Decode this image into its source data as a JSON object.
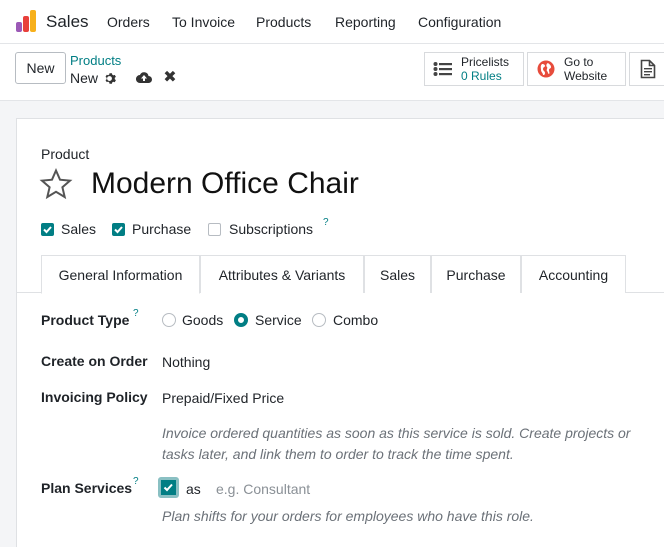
{
  "app": {
    "name": "Sales",
    "logo_colors": [
      "#e8403b",
      "#f7b01b",
      "#9b59b6"
    ]
  },
  "nav": [
    "Orders",
    "To Invoice",
    "Products",
    "Reporting",
    "Configuration"
  ],
  "control": {
    "new_label": "New",
    "breadcrumb_parent": "Products",
    "breadcrumb_current": "New",
    "smart_buttons": [
      {
        "label": "Pricelists",
        "value": "0 Rules",
        "icon": "list-icon"
      },
      {
        "label": "Go to",
        "value": "Website",
        "icon": "globe-icon"
      }
    ]
  },
  "form": {
    "product_label": "Product",
    "product_name": "Modern Office Chair",
    "checkboxes": [
      {
        "label": "Sales",
        "checked": true
      },
      {
        "label": "Purchase",
        "checked": true
      },
      {
        "label": "Subscriptions",
        "checked": false
      }
    ],
    "help_mark": "?",
    "tabs": [
      "General Information",
      "Attributes & Variants",
      "Sales",
      "Purchase",
      "Accounting"
    ],
    "active_tab": "General Information",
    "product_type": {
      "label": "Product Type",
      "options": [
        "Goods",
        "Service",
        "Combo"
      ],
      "selected": "Service"
    },
    "create_on_order": {
      "label": "Create on Order",
      "value": "Nothing"
    },
    "invoicing_policy": {
      "label": "Invoicing Policy",
      "value": "Prepaid/Fixed Price",
      "hint_line1": "Invoice ordered quantities as soon as this service is sold. Create projects or",
      "hint_line2": "tasks later, and link them to order to track the time spent."
    },
    "plan_services": {
      "label": "Plan Services",
      "checked": true,
      "as_label": "as",
      "placeholder": "e.g. Consultant",
      "hint": "Plan shifts for your orders for employees who have this role."
    }
  },
  "colors": {
    "accent": "#017e84"
  }
}
